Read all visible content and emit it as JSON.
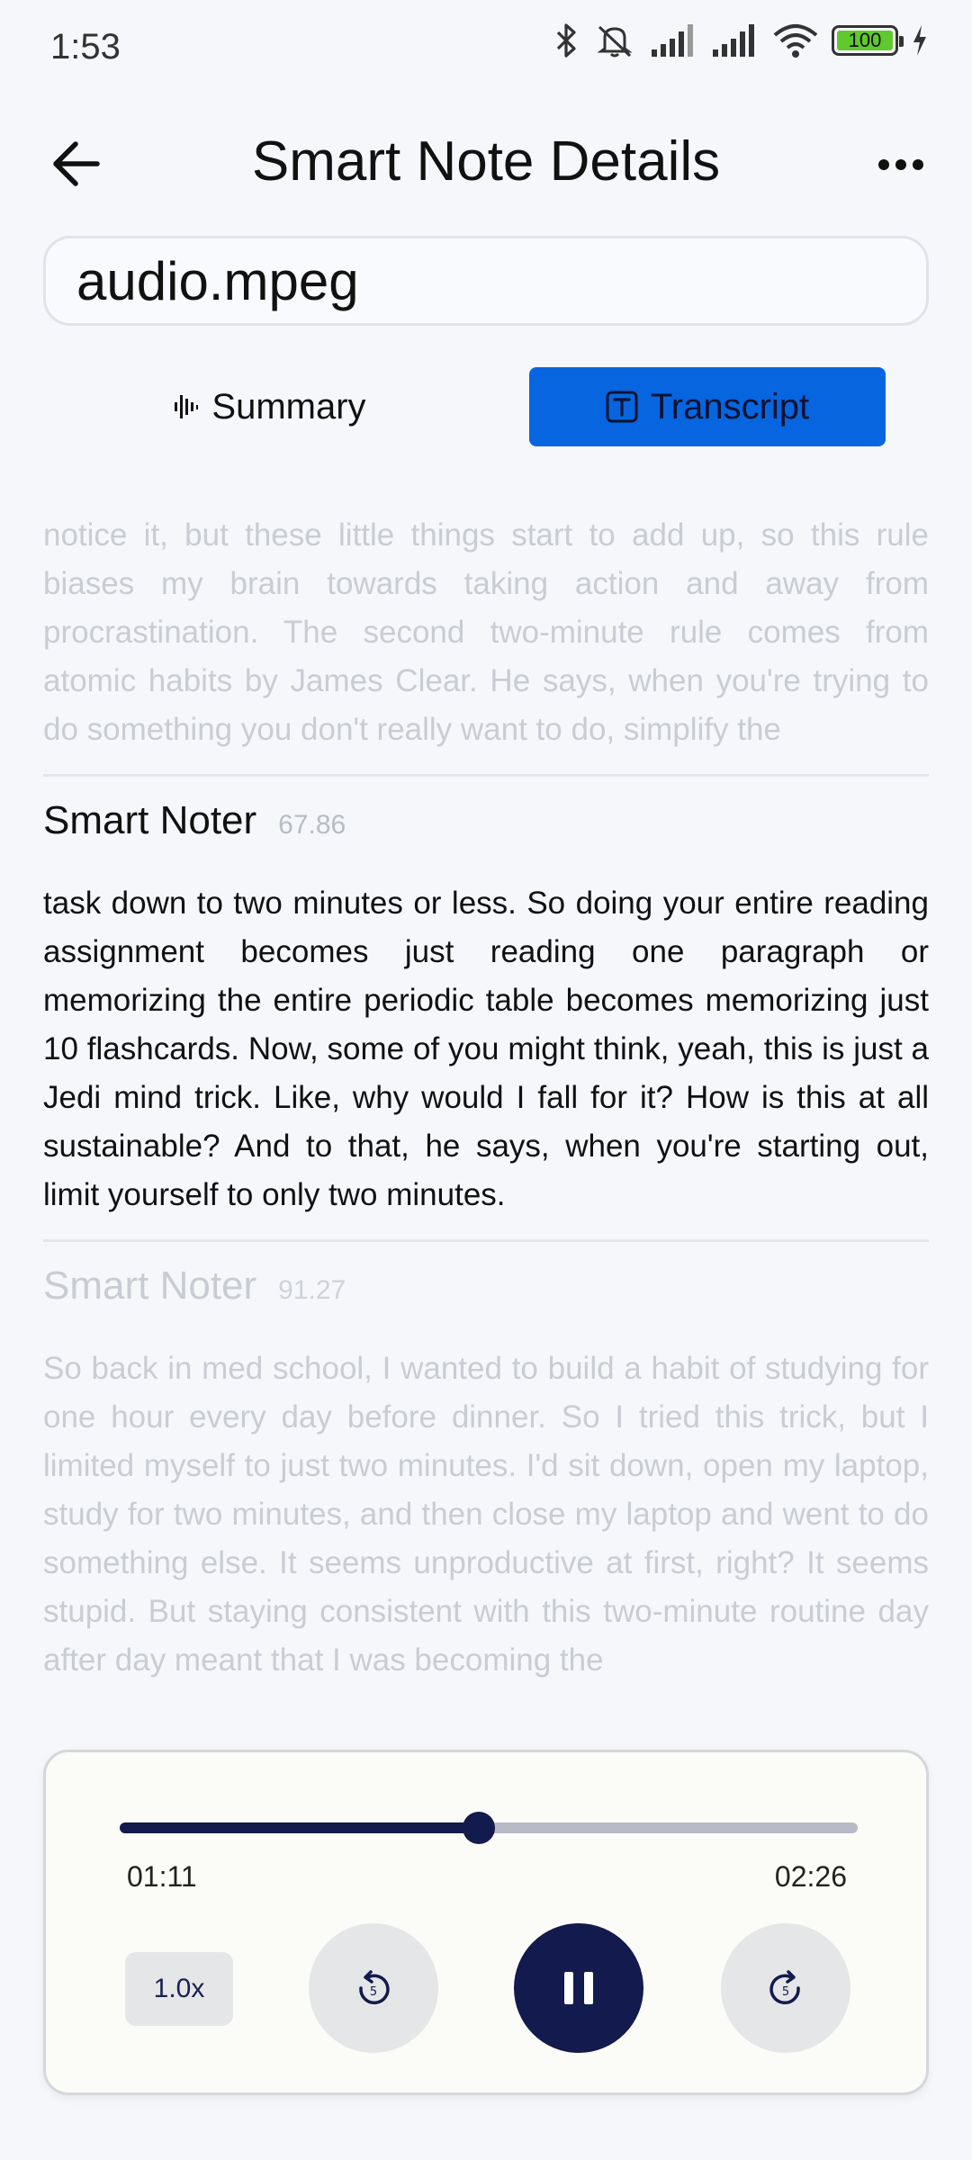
{
  "status_bar": {
    "time": "1:53",
    "battery": "100",
    "icons": [
      "bluetooth-icon",
      "mute-icon",
      "signal-icon",
      "signal-icon",
      "wifi-icon",
      "battery-icon",
      "charging-icon"
    ]
  },
  "header": {
    "title": "Smart Note Details",
    "back_icon": "arrow-left-icon",
    "more_icon": "more-horizontal-icon"
  },
  "file": {
    "name": "audio.mpeg"
  },
  "tabs": [
    {
      "label": "Summary",
      "icon": "waveform-icon",
      "active": false
    },
    {
      "label": "Transcript",
      "icon": "text-box-icon",
      "active": true
    }
  ],
  "transcript": {
    "top_fragment": "notice it, but these little things start to add up, so this rule biases my brain towards taking action and away from procrastination. The second two-minute rule comes from atomic habits by James Clear. He says, when you're trying to do something you don't really want to do, simplify the",
    "segments": [
      {
        "speaker": "Smart Noter",
        "time": "67.86",
        "text": "task down to two minutes or less. So doing your entire reading assignment becomes just reading one paragraph or memorizing the entire periodic table becomes memorizing just 10 flashcards. Now, some of you might think, yeah, this is just a Jedi mind trick. Like, why would I fall for it? How is this at all sustainable? And to that, he says, when you're starting out, limit yourself to only two minutes."
      },
      {
        "speaker": "Smart Noter",
        "time": "91.27",
        "text": "So back in med school, I wanted to build a habit of studying for one hour every day before dinner. So I tried this trick, but I limited myself to just two minutes. I'd sit down, open my laptop, study for two minutes, and then close my laptop and went to do something else. It seems unproductive at first, right? It seems stupid. But staying consistent with this two-minute routine day after day meant that I was becoming the"
      }
    ]
  },
  "player": {
    "current_time": "01:11",
    "total_time": "02:26",
    "progress": 0.486,
    "speed": "1.0x",
    "skip_seconds": "5",
    "state": "playing"
  }
}
